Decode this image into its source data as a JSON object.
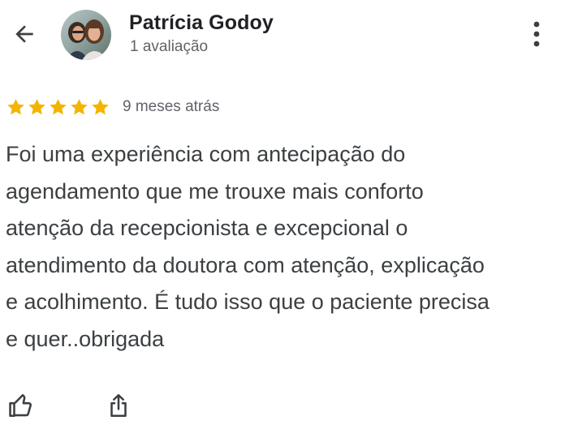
{
  "header": {
    "back_icon": "arrow-back-icon",
    "author_name": "Patrícia Godoy",
    "review_count": "1 avaliação",
    "more_icon": "more-vert-icon"
  },
  "review": {
    "rating": 5,
    "rating_max": 5,
    "star_color": "#f4b400",
    "time_ago": "9 meses atrás",
    "text": "Foi uma experiência com antecipação do\nagendamento que me trouxe mais conforto\natenção da recepcionista e excepcional o\natendimento da doutora com atenção, explicação\ne acolhimento. É tudo isso que o paciente precisa\ne quer..obrigada"
  },
  "actions": {
    "like_icon": "thumb-up-icon",
    "share_icon": "share-icon"
  }
}
